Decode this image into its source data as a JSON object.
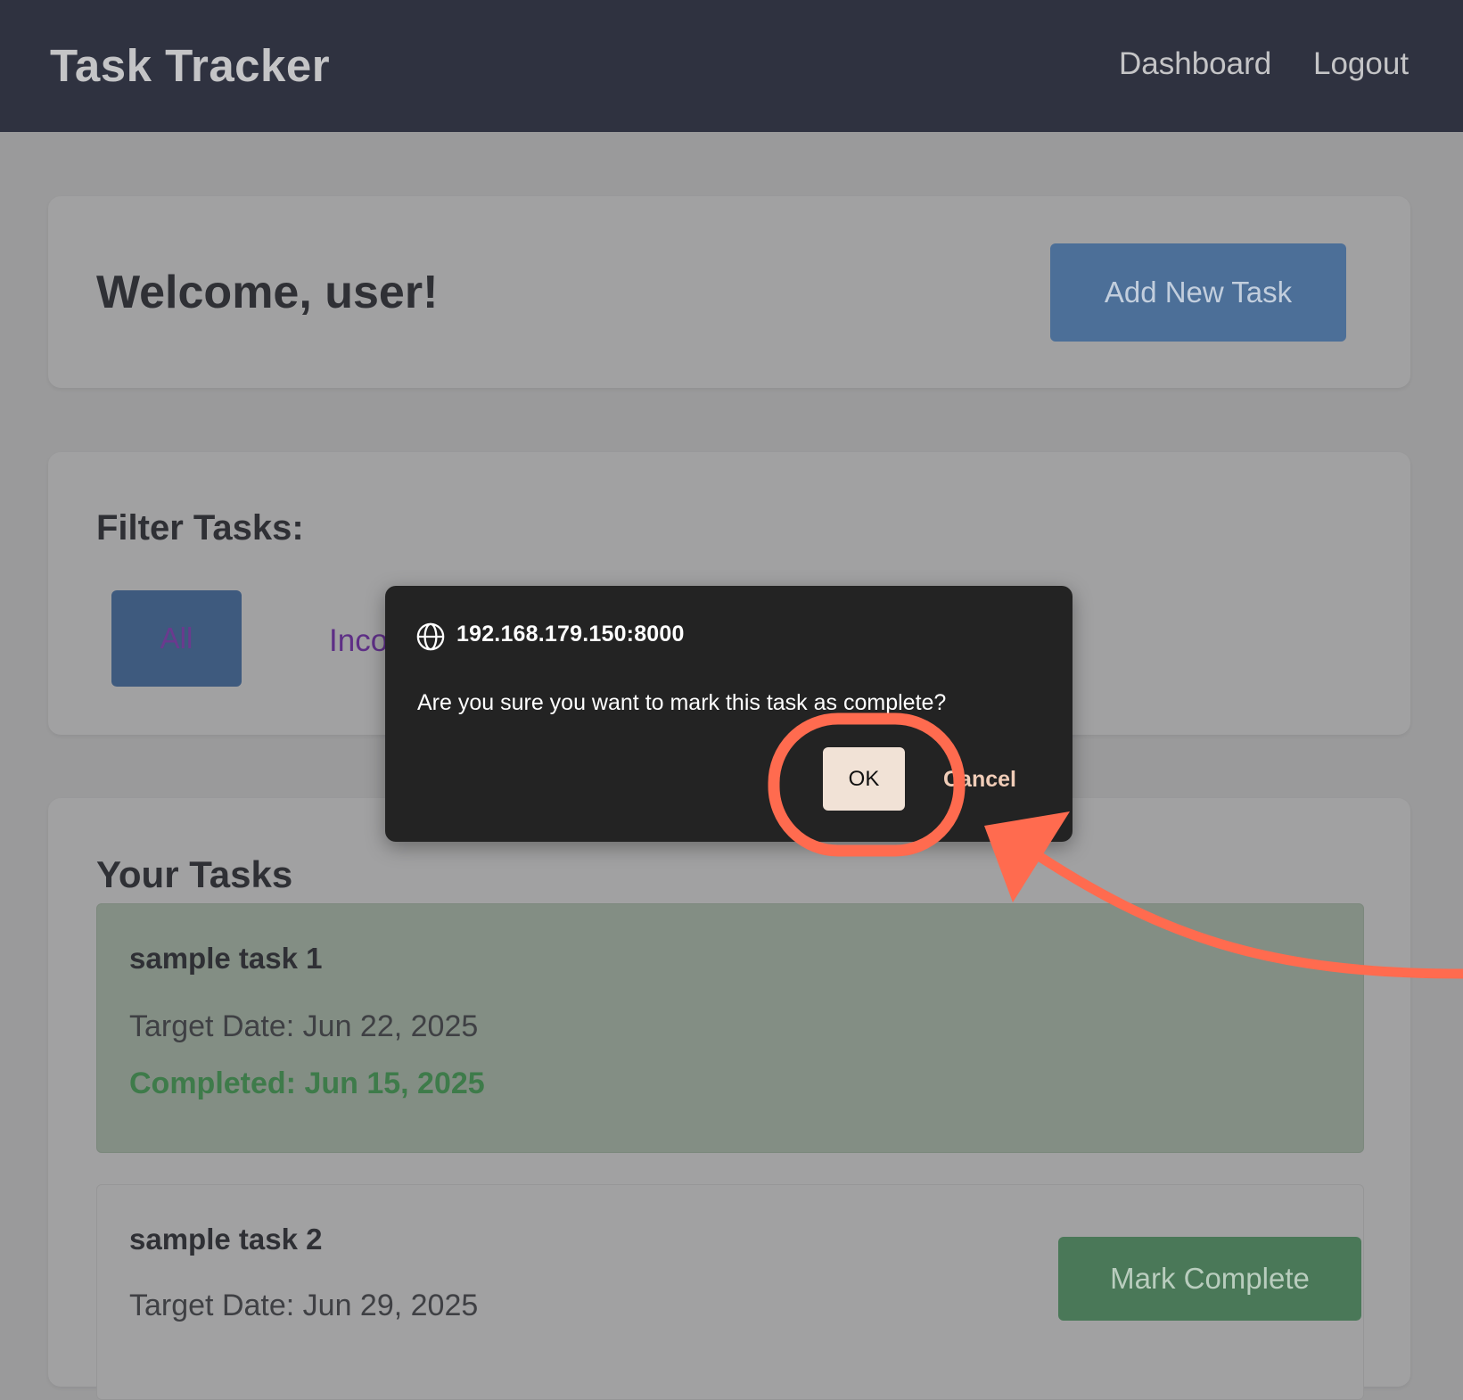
{
  "navbar": {
    "brand": "Task Tracker",
    "links": [
      "Dashboard",
      "Logout"
    ]
  },
  "welcome": {
    "title": "Welcome, user!",
    "add_button": "Add New Task"
  },
  "filter": {
    "title": "Filter Tasks:",
    "all_button": "All",
    "incomplete_link_visible": "Inco"
  },
  "tasks": {
    "title": "Your Tasks",
    "items": [
      {
        "name": "sample task 1",
        "target_date": "Target Date: Jun 22, 2025",
        "completed": "Completed: Jun 15, 2025"
      },
      {
        "name": "sample task 2",
        "target_date": "Target Date: Jun 29, 2025",
        "action": "Mark Complete"
      }
    ]
  },
  "dialog": {
    "origin": "192.168.179.150:8000",
    "message": "Are you sure you want to mark this task as complete?",
    "ok_label": "OK",
    "cancel_label": "Cancel",
    "icon": "globe-icon"
  },
  "annotation": {
    "color": "#ff6b4f",
    "shapes": [
      "highlight-circle",
      "pointer-arrow"
    ]
  },
  "colors": {
    "navbar": "#2f3240",
    "page_dimmed": "#9a9a9b",
    "primary_button": "#4c6f98",
    "success_button": "#4a7858",
    "completed_text": "#3e7b4a",
    "dialog_bg": "#232323"
  }
}
